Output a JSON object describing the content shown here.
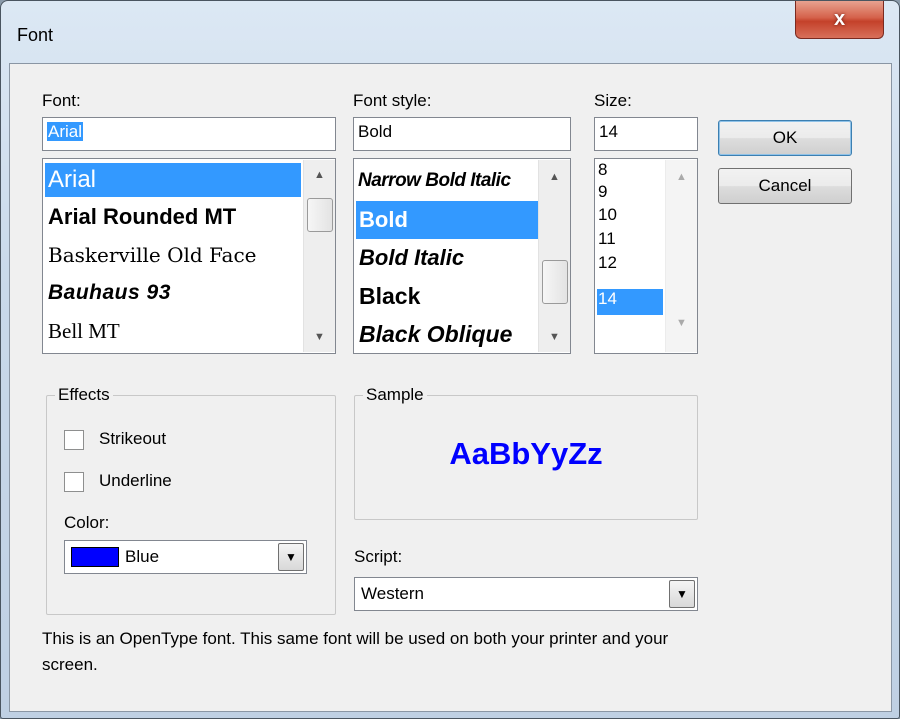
{
  "window": {
    "title": "Font",
    "close_label": "x"
  },
  "font": {
    "label": "Font:",
    "value": "Arial",
    "items": [
      "Arial",
      "Arial Rounded MT",
      "Baskerville Old Face",
      "Bauhaus 93",
      "Bell MT"
    ],
    "selected_index": 0
  },
  "font_style": {
    "label": "Font style:",
    "value": "Bold",
    "items": [
      "Narrow Bold Italic",
      "Bold",
      "Bold Italic",
      "Black",
      "Black Oblique"
    ],
    "selected_index": 1
  },
  "size": {
    "label": "Size:",
    "value": "14",
    "items": [
      "8",
      "9",
      "10",
      "11",
      "12",
      "14"
    ],
    "selected_index": 5
  },
  "buttons": {
    "ok": "OK",
    "cancel": "Cancel"
  },
  "effects": {
    "title": "Effects",
    "strikeout": "Strikeout",
    "underline": "Underline",
    "color_label": "Color:",
    "color_value": "Blue",
    "color_hex": "#0000ff"
  },
  "sample": {
    "title": "Sample",
    "text": "AaBbYyZz",
    "color": "#0000ff"
  },
  "script": {
    "label": "Script:",
    "value": "Western"
  },
  "description": "This is an OpenType font. This same font will be used on both your printer and your screen.",
  "colors": {
    "selection": "#3399ff",
    "close_button": "#c4412a"
  },
  "icons": {
    "close": "close-icon",
    "scroll_up": "chevron-up-icon",
    "scroll_down": "chevron-down-icon",
    "dropdown": "dropdown-arrow-icon"
  }
}
